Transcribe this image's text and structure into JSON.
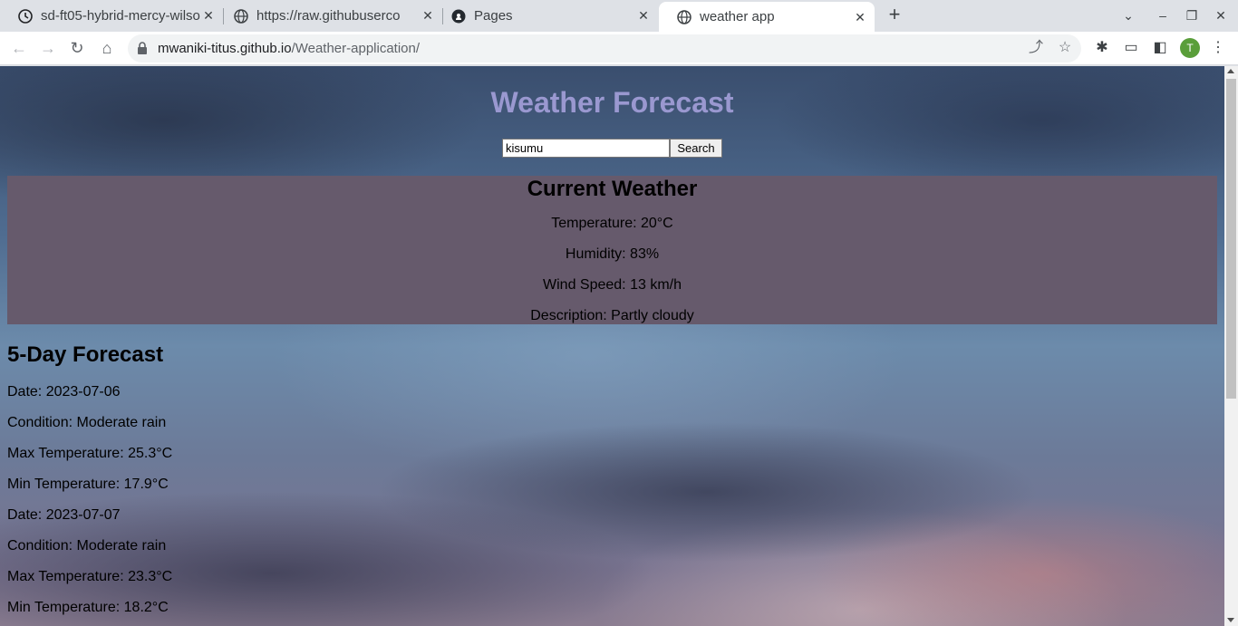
{
  "browser": {
    "tabs": [
      {
        "title": "sd-ft05-hybrid-mercy-wilso",
        "icon": "github-clock-icon"
      },
      {
        "title": "https://raw.githubuserco",
        "icon": "globe-icon"
      },
      {
        "title": "Pages",
        "icon": "github-icon"
      },
      {
        "title": "weather app",
        "icon": "globe-icon",
        "active": true
      }
    ],
    "url_host": "mwaniki-titus.github.io",
    "url_path": "/Weather-application/",
    "profile_initial": "T",
    "profile_color": "#5a9e3a"
  },
  "page": {
    "title": "Weather Forecast",
    "title_color": "#9a98d0",
    "search": {
      "value": "kisumu",
      "button_label": "Search"
    },
    "current": {
      "heading": "Current Weather",
      "temperature": "Temperature: 20°C",
      "humidity": "Humidity: 83%",
      "wind": "Wind Speed: 13 km/h",
      "description": "Description: Partly cloudy",
      "panel_color": "#665a6c"
    },
    "forecast": {
      "heading": "5-Day Forecast",
      "days": [
        {
          "date": "Date: 2023-07-06",
          "condition": "Condition: Moderate rain",
          "max": "Max Temperature: 25.3°C",
          "min": "Min Temperature: 17.9°C"
        },
        {
          "date": "Date: 2023-07-07",
          "condition": "Condition: Moderate rain",
          "max": "Max Temperature: 23.3°C",
          "min": "Min Temperature: 18.2°C"
        }
      ]
    }
  }
}
